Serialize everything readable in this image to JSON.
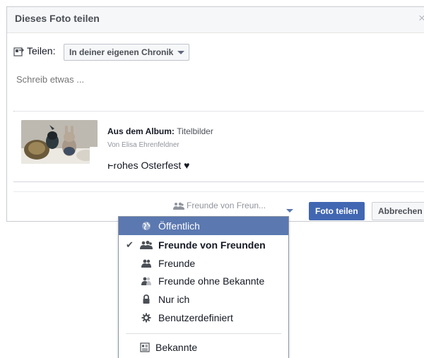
{
  "dialog": {
    "title": "Dieses Foto teilen",
    "close_glyph": "×"
  },
  "share": {
    "label": "Teilen:",
    "target": "In deiner eigenen Chronik"
  },
  "composer": {
    "placeholder": "Schreib etwas ..."
  },
  "attachment": {
    "album_prefix": "Aus dem Album:",
    "album_name": "Titelbilder",
    "author": "Von Elisa Ehrenfeldner",
    "caption": "Frohes Osterfest ♥"
  },
  "footer": {
    "audience": "Freunde von Freun...",
    "share_button": "Foto teilen",
    "cancel_button": "Abbrechen"
  },
  "menu": {
    "items": [
      {
        "label": "Öffentlich",
        "icon": "globe-icon",
        "highlighted": true,
        "checked": false
      },
      {
        "label": "Freunde von Freunden",
        "icon": "friends-of-friends-icon",
        "highlighted": false,
        "checked": true
      },
      {
        "label": "Freunde",
        "icon": "friends-icon",
        "highlighted": false,
        "checked": false
      },
      {
        "label": "Freunde ohne Bekannte",
        "icon": "friends-except-icon",
        "highlighted": false,
        "checked": false
      },
      {
        "label": "Nur ich",
        "icon": "lock-icon",
        "highlighted": false,
        "checked": false
      },
      {
        "label": "Benutzerdefiniert",
        "icon": "gear-icon",
        "highlighted": false,
        "checked": false
      },
      {
        "label": "Bekannte",
        "icon": "list-icon",
        "highlighted": false,
        "checked": false
      }
    ],
    "check_glyph": "✔"
  },
  "colors": {
    "primary": "#4267b2",
    "menu_highlight": "#5b78b0",
    "header_bg": "#f6f7f9"
  }
}
